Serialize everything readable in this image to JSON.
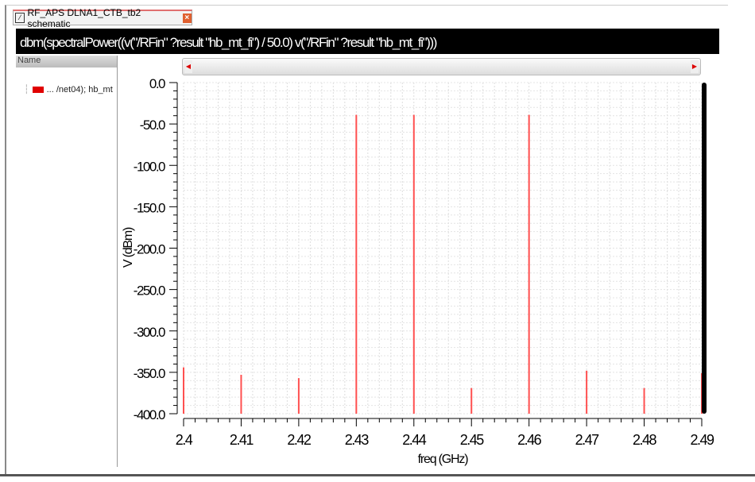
{
  "tab": {
    "label": "RF_APS DLNA1_CTB_tb2 schematic",
    "close": "×"
  },
  "title": "dbm(spectralPower((v(\"/RFin\" ?result \"hb_mt_fi\") / 50.0) v(\"/RFin\" ?result \"hb_mt_fi\")))",
  "panel": {
    "header": "Name",
    "trace": "... /net04); hb_mt"
  },
  "colors": {
    "trace": "#ff5050"
  },
  "chart_data": {
    "type": "bar",
    "xlabel": "freq (GHz)",
    "ylabel": "V (dBm)",
    "xlim": [
      2.4,
      2.49
    ],
    "ylim": [
      -400,
      0
    ],
    "xticks": [
      "2.4",
      "2.41",
      "2.42",
      "2.43",
      "2.44",
      "2.45",
      "2.46",
      "2.47",
      "2.48",
      "2.49"
    ],
    "yticks": [
      "0.0",
      "-50.0",
      "-100.0",
      "-150.0",
      "-200.0",
      "-250.0",
      "-300.0",
      "-350.0",
      "-400.0"
    ],
    "x": [
      2.4,
      2.41,
      2.42,
      2.43,
      2.44,
      2.45,
      2.46,
      2.47,
      2.48,
      2.49
    ],
    "values": [
      -344,
      -353,
      -357,
      -39,
      -39,
      -369,
      -39,
      -348,
      -369,
      -351
    ],
    "grid": true
  }
}
